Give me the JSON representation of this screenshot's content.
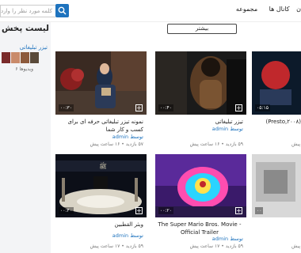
{
  "header": {
    "search_placeholder": "کلمه مورد نظر را وارد کنید",
    "nav": [
      "ن",
      "کانال ها",
      "مجموعه"
    ]
  },
  "sidebar": {
    "title": "لیست پخش ب",
    "item_label": "تیزر تبلیغاتی",
    "item_count": "ویدیوها ۶"
  },
  "main": {
    "more_label": "بیشتر",
    "cards": [
      {
        "title": "نمونه تیزر تبلیغاتی حرفه ای برای کسب و کار شما",
        "by": "توسط admin",
        "meta": "۵۷ بازدید  •  ۱۶ ساعت پیش",
        "duration": "۰۰:۳۰"
      },
      {
        "title": "تیزر تبلیغاتی",
        "by": "توسط admin",
        "meta": "۵۹ بازدید  •  ۱۶ ساعت پیش",
        "duration": "۰۰:۴۰"
      },
      {
        "title": "(Presto,۲۰۰۸)",
        "by": "",
        "meta": "پیش",
        "duration": "۰۵:۱۵"
      },
      {
        "title": "وبثر القطبين",
        "by": "توسط admin",
        "meta": "۵۹ بازدید  •  ۱۷ ساعت پیش",
        "duration": "۰۰:۴۰"
      },
      {
        "title": "The Super Mario Bros. Movie - Official Trailer",
        "by": "توسط admin",
        "meta": "۵۹ بازدید  •  ۱۷ ساعت پیش",
        "duration": "۰۰:۲۰"
      },
      {
        "title": "",
        "by": "",
        "meta": "پیش",
        "duration": "۰۰"
      }
    ]
  },
  "colors": {
    "accent": "#1e73be",
    "sidebar_bg": "#f3f4f6"
  }
}
